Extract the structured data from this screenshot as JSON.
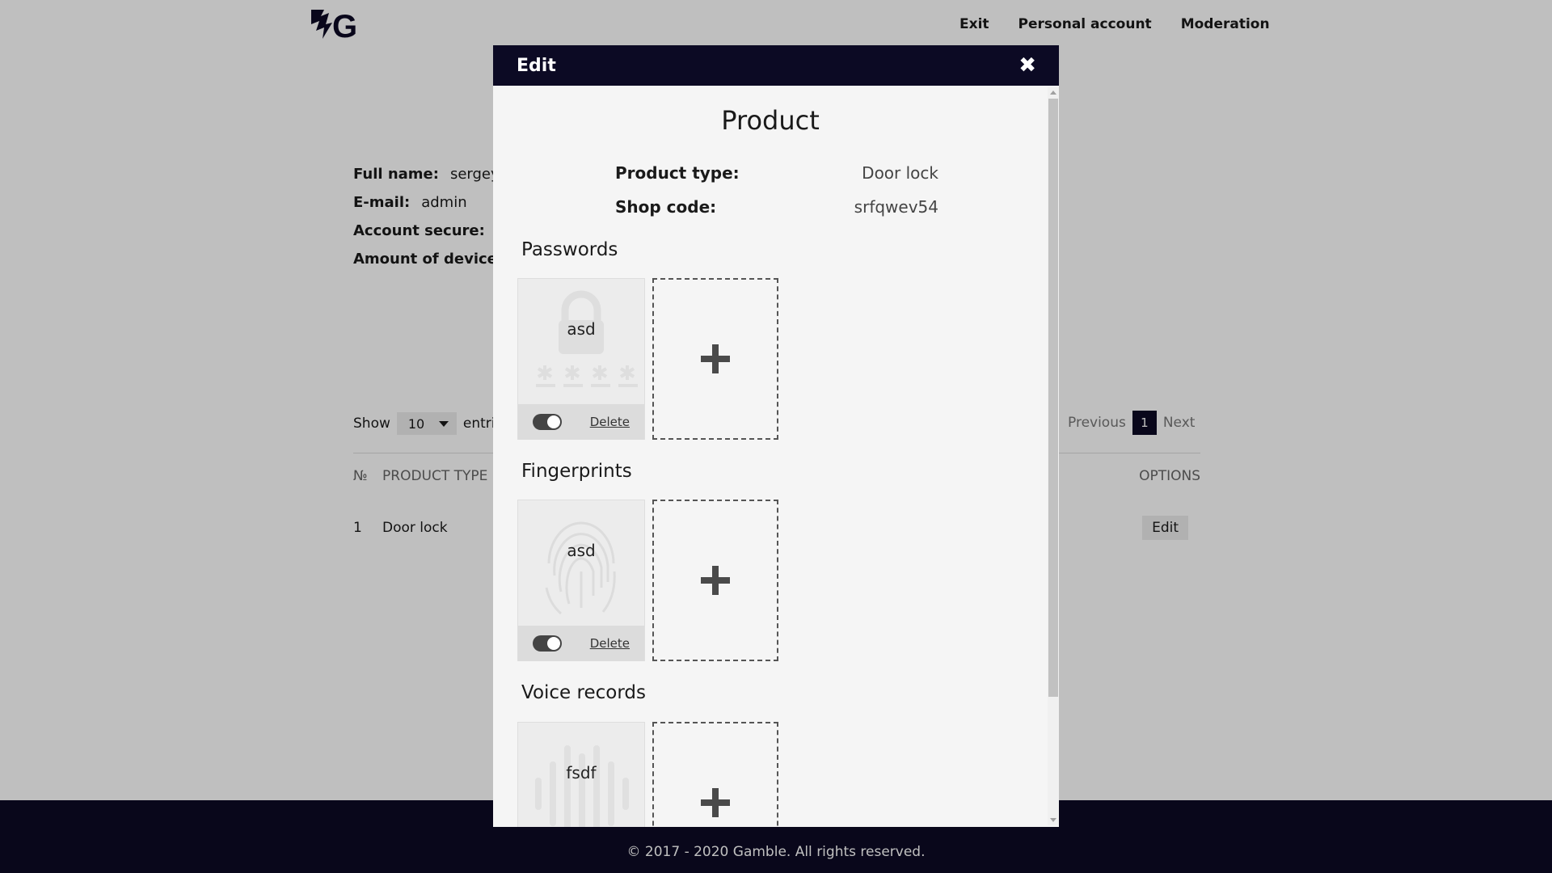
{
  "nav": {
    "exit": "Exit",
    "personal_account": "Personal account",
    "moderation": "Moderation"
  },
  "profile": {
    "full_name_label": "Full name:",
    "full_name_value": "sergey",
    "email_label": "E-mail:",
    "email_value": "admin",
    "secure_label": "Account secure:",
    "devices_label": "Amount of devices"
  },
  "table_controls": {
    "show_label": "Show",
    "show_value": "10",
    "entries_label": "entri",
    "previous": "Previous",
    "page": "1",
    "next": "Next"
  },
  "table": {
    "headers": {
      "no": "№",
      "product_type": "PRODUCT TYPE",
      "options": "OPTIONS"
    },
    "rows": [
      {
        "no": "1",
        "product_type": "Door lock",
        "action": "Edit"
      }
    ]
  },
  "footer": {
    "copyright": "© 2017 - 2020 Gamble. All rights reserved."
  },
  "modal": {
    "title": "Edit",
    "product_title": "Product",
    "product_type_label": "Product type:",
    "product_type_value": "Door lock",
    "shop_code_label": "Shop code:",
    "shop_code_value": "srfqwev54",
    "sections": {
      "passwords": {
        "title": "Passwords",
        "card_name": "asd",
        "delete": "Delete"
      },
      "fingerprints": {
        "title": "Fingerprints",
        "card_name": "asd",
        "delete": "Delete"
      },
      "voice": {
        "title": "Voice records",
        "card_name": "fsdf"
      }
    }
  },
  "colors": {
    "dark": "#0c0a24",
    "overlay": "rgba(0,0,0,0.25)",
    "modal_bg": "#f5f5f5"
  },
  "icons": [
    "logo",
    "close-icon",
    "lock-icon",
    "fingerprint-icon",
    "waveform-icon",
    "plus-icon",
    "caret-down-icon"
  ]
}
